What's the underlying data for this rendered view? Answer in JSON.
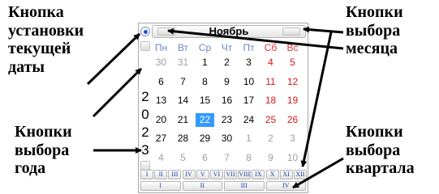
{
  "annotations": {
    "today": "Кнопка\nустановки\nтекущей\nдаты",
    "year": "Кнопки\nвыбора\nгода",
    "month": "Кнопки\nвыбора\nмесяца",
    "quarter": "Кнопки\nвыбора\nквартала"
  },
  "calendar": {
    "month_title": "Ноябрь",
    "year_digits": [
      "2",
      "0",
      "2",
      "3"
    ],
    "weekdays": [
      "Пн",
      "Вт",
      "Ср",
      "Чт",
      "Пт",
      "Сб",
      "Вс"
    ],
    "weeks": [
      [
        "30",
        "31",
        "1",
        "2",
        "3",
        "4",
        "5"
      ],
      [
        "6",
        "7",
        "8",
        "9",
        "10",
        "11",
        "12"
      ],
      [
        "13",
        "14",
        "15",
        "16",
        "17",
        "18",
        "19"
      ],
      [
        "20",
        "21",
        "22",
        "23",
        "24",
        "25",
        "26"
      ],
      [
        "27",
        "28",
        "29",
        "30",
        "1",
        "2",
        "3"
      ],
      [
        "4",
        "5",
        "6",
        "7",
        "8",
        "9",
        "10"
      ]
    ],
    "selected_day": "22",
    "month_buttons": [
      "I",
      "II",
      "III",
      "IV",
      "V",
      "VI",
      "VII",
      "VIII",
      "IX",
      "X",
      "XI",
      "XII"
    ],
    "quarter_buttons": [
      "I",
      "II",
      "III",
      "IV"
    ],
    "icons": {
      "today": "radio-dot-icon",
      "prev_month": "left-arrow-icon",
      "next_month": "right-arrow-icon"
    },
    "colors": {
      "accent": "#3399ff",
      "weekend": "#d81818",
      "weekday_header": "#6e88c8",
      "other_month": "#a0a0a0",
      "button_text": "#1a3fa8"
    }
  }
}
